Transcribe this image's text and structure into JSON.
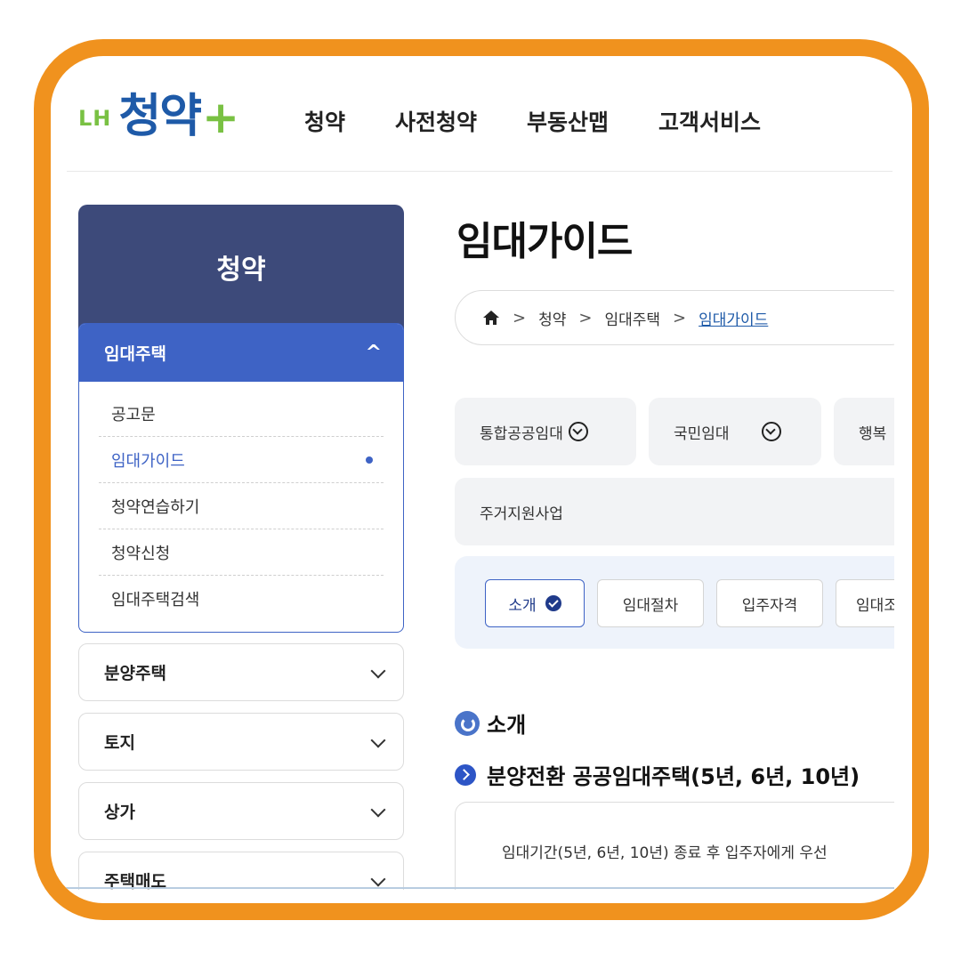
{
  "logo": {
    "lh": "LH",
    "main": "청약",
    "plus": "+"
  },
  "gnb": [
    "청약",
    "사전청약",
    "부동산맵",
    "고객서비스"
  ],
  "sidebar": {
    "title": "청약",
    "open_menu": {
      "label": "임대주택",
      "chevron": "^",
      "items": [
        "공고문",
        "임대가이드",
        "청약연습하기",
        "청약신청",
        "임대주택검색"
      ],
      "active_index": 1
    },
    "menus": [
      "분양주택",
      "토지",
      "상가",
      "주택매도"
    ]
  },
  "main": {
    "title": "임대가이드",
    "breadcrumb": [
      "청약",
      "임대주택",
      "임대가이드"
    ],
    "categories": [
      "통합공공임대",
      "국민임대",
      "행복"
    ],
    "category_wide": "주거지원사업",
    "tabs": [
      "소개",
      "임대절차",
      "입주자격",
      "임대조"
    ],
    "section_title": "소개",
    "sub_title": "분양전환 공공임대주택(5년, 6년, 10년)",
    "description": "임대기간(5년, 6년, 10년) 종료 후 입주자에게 우선"
  }
}
